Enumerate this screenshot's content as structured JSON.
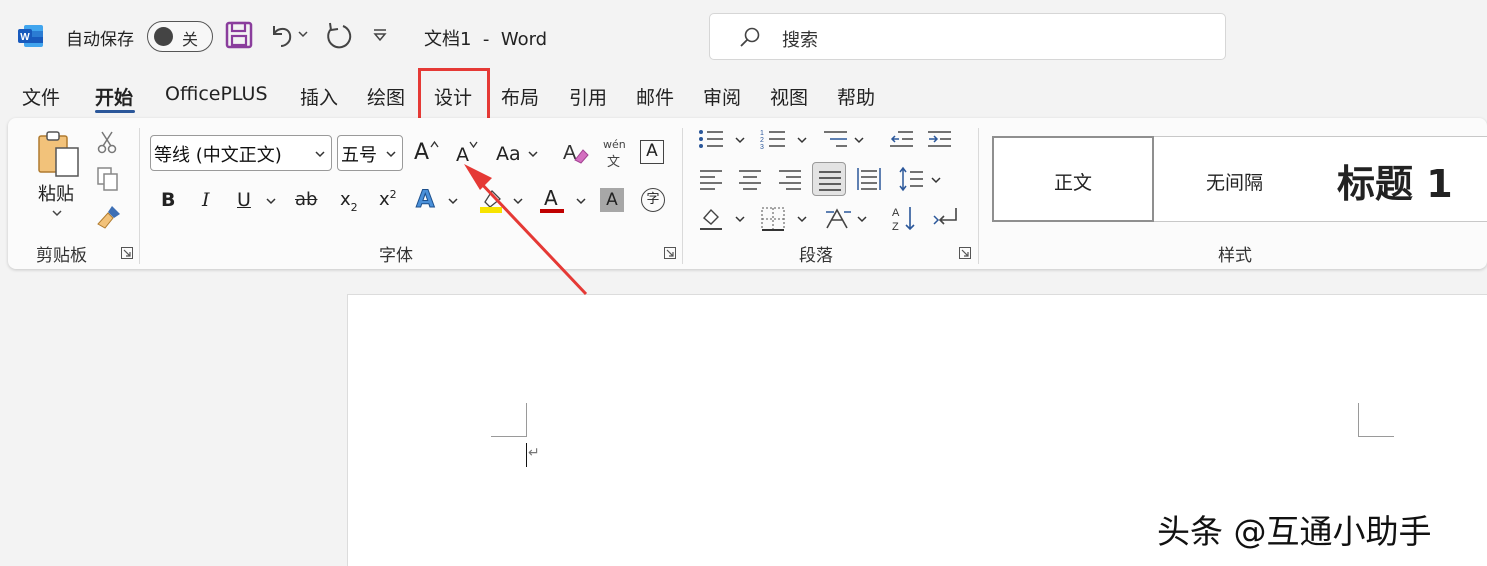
{
  "titlebar": {
    "autosave_label": "自动保存",
    "autosave_state": "关",
    "doc_title": "文档1  -  Word",
    "search_placeholder": "搜索"
  },
  "tabs": [
    "文件",
    "开始",
    "OfficePLUS",
    "插入",
    "绘图",
    "设计",
    "布局",
    "引用",
    "邮件",
    "审阅",
    "视图",
    "帮助"
  ],
  "active_tab": "开始",
  "highlighted_tab": "设计",
  "clipboard": {
    "paste_label": "粘贴",
    "group_label": "剪贴板"
  },
  "font": {
    "font_name": "等线 (中文正文)",
    "font_size": "五号",
    "aa_label": "Aa",
    "phonetic_top": "wén",
    "phonetic_bottom": "文",
    "boxed_char": "A",
    "bold": "B",
    "italic": "I",
    "underline": "U",
    "strike": "ab",
    "subscript_base": "x",
    "subscript": "2",
    "superscript_base": "x",
    "superscript": "2",
    "text_effect": "A",
    "font_color": "A",
    "char_shading": "A",
    "enclosed_char": "字",
    "group_label": "字体",
    "grow_label": "A",
    "shrink_label": "A"
  },
  "paragraph": {
    "group_label": "段落"
  },
  "styles": {
    "items": [
      "正文",
      "无间隔",
      "标题 1"
    ],
    "group_label": "样式"
  },
  "colors": {
    "accent": "#2b579a",
    "highlight_red": "#e53935",
    "font_color_bar": "#c00000",
    "highlight_yellow": "#f7e300"
  },
  "watermark": "头条 @互通小助手",
  "para_mark": "↵"
}
